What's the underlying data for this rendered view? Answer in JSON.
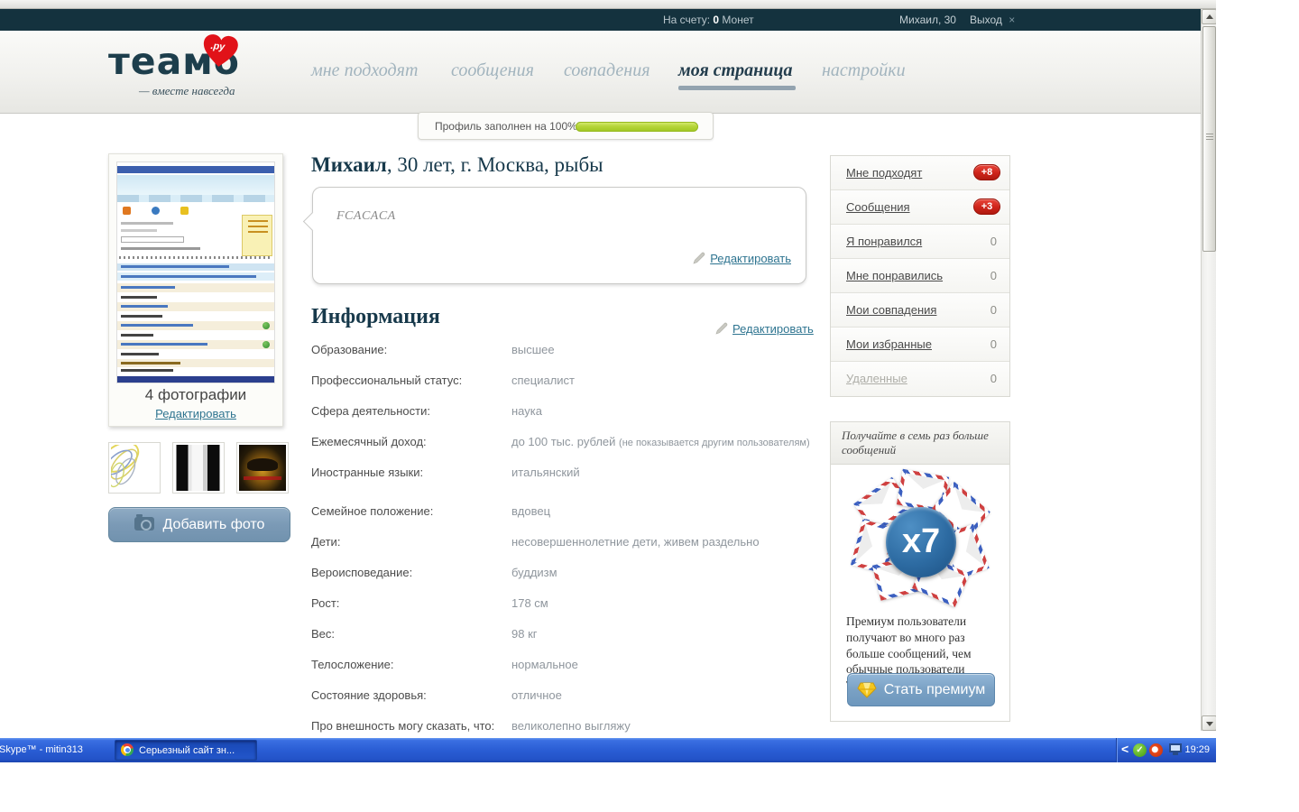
{
  "topbar": {
    "balance_label": "На счету:",
    "balance_value": "0",
    "balance_unit": "Монет",
    "user": "Михаил, 30",
    "logout": "Выход",
    "close": "×"
  },
  "header": {
    "logo_text": "теамо",
    "logo_tld": ".ру",
    "tagline": "— вместе навсегда",
    "nav": [
      {
        "label": "мне подходят"
      },
      {
        "label": "сообщения"
      },
      {
        "label": "совпадения"
      },
      {
        "label": "моя страница",
        "active": true
      },
      {
        "label": "настройки"
      }
    ]
  },
  "progress": {
    "label": "Профиль заполнен на 100%",
    "percent": 100
  },
  "photos": {
    "caption": "4 фотографии",
    "edit_link": "Редактировать",
    "add_button": "Добавить фото"
  },
  "profile": {
    "name": "Михаил",
    "details": ", 30 лет, г. Москва, рыбы",
    "status_text": "FCACACA",
    "status_edit": "Редактировать",
    "info_title": "Информация",
    "info_edit": "Редактировать",
    "fields": [
      {
        "label": "Образование:",
        "value": "высшее",
        "note": ""
      },
      {
        "label": "Профессиональный статус:",
        "value": "специалист",
        "note": ""
      },
      {
        "label": "Сфера деятельности:",
        "value": "наука",
        "note": ""
      },
      {
        "label": "Ежемесячный доход:",
        "value": "до 100 тыс. рублей",
        "note": "(не показывается другим пользователям)"
      },
      {
        "label": "Иностранные языки:",
        "value": "итальянский",
        "note": ""
      },
      {
        "label": "Семейное положение:",
        "value": "вдовец",
        "note": ""
      },
      {
        "label": "Дети:",
        "value": "несовершеннолетние дети, живем раздельно",
        "note": ""
      },
      {
        "label": "Вероисповедание:",
        "value": "буддизм",
        "note": ""
      },
      {
        "label": "Рост:",
        "value": "178 см",
        "note": ""
      },
      {
        "label": "Вес:",
        "value": "98 кг",
        "note": ""
      },
      {
        "label": "Телосложение:",
        "value": "нормальное",
        "note": ""
      },
      {
        "label": "Состояние здоровья:",
        "value": "отличное",
        "note": ""
      },
      {
        "label": "Про внешность могу сказать, что:",
        "value": "великолепно выгляжу",
        "note": ""
      }
    ]
  },
  "sidebar": {
    "menu": [
      {
        "label": "Мне подходят",
        "badge": "+8"
      },
      {
        "label": "Сообщения",
        "badge": "+3"
      },
      {
        "label": "Я понравился",
        "count": "0"
      },
      {
        "label": "Мне понравились",
        "count": "0"
      },
      {
        "label": "Мои совпадения",
        "count": "0"
      },
      {
        "label": "Мои избранные",
        "count": "0"
      },
      {
        "label": "Удаленные",
        "count": "0"
      }
    ],
    "promo": {
      "header": "Получайте в семь раз больше сообщений",
      "multiplier": "x7",
      "body": "Премиум пользователи получают во много раз больше сообщений, чем обычные пользователи Teamo.ру",
      "button": "Стать премиум"
    }
  },
  "taskbar": {
    "task1": "Skype™ - mitin313",
    "task2": "Серьезный сайт зн...",
    "clock": "19:29"
  },
  "colors": {
    "topbar_bg": "#14323e",
    "badge_red": "#ce241a",
    "progress_green": "#aed136",
    "link_teal": "#2e7490",
    "premium_blue": "#6d97bd",
    "taskbar_blue": "#2a5dd4"
  }
}
